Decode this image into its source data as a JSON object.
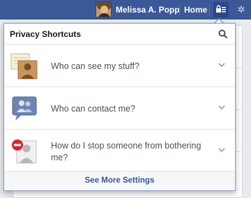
{
  "topbar": {
    "user_name": "Melissa A. Popp",
    "home_label": "Home"
  },
  "privacy": {
    "title": "Privacy Shortcuts",
    "items": [
      {
        "label": "Who can see my stuff?",
        "icon": "photo-profile-icon"
      },
      {
        "label": "Who can contact me?",
        "icon": "chat-people-icon"
      },
      {
        "label": "How do I stop someone from bothering me?",
        "icon": "block-user-icon"
      }
    ],
    "footer_link": "See More Settings"
  },
  "colors": {
    "bar": "#3b5998",
    "link": "#365899",
    "chevron": "#8b9dc3"
  }
}
